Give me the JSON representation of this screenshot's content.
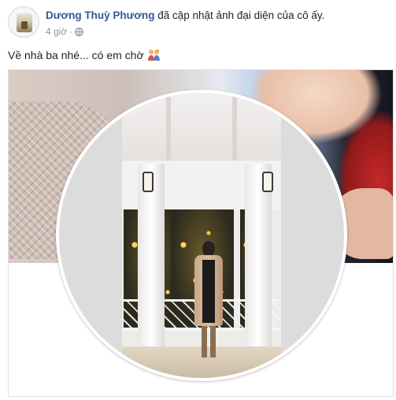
{
  "post": {
    "author_name": "Dương Thuỳ Phương",
    "action_text": "đã cập nhật ảnh đại diện của cô ấy.",
    "time": "4 giờ",
    "separator": "·",
    "privacy_icon": "globe-icon",
    "caption": "Về nhà ba nhé... có em chờ",
    "caption_emoji": "couple-emoji-icon"
  },
  "colors": {
    "author_link": "#365899",
    "meta_text": "#90949c",
    "body_text": "#1d2129",
    "card_border": "#dddfe2"
  },
  "media": {
    "cover_photo": "cover-photo",
    "profile_photo": "profile-photo"
  }
}
